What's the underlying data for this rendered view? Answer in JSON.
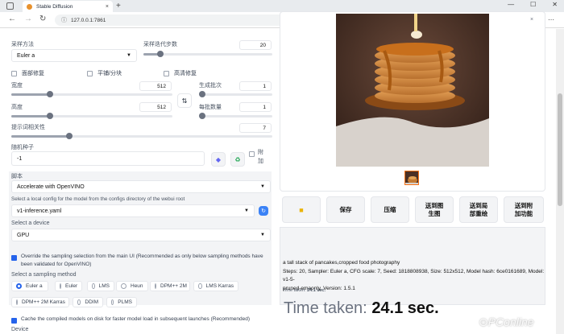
{
  "browser": {
    "tab_title": "Stable Diffusion",
    "url": "127.0.0.1:7861",
    "tab_close": "×",
    "new_tab": "+",
    "win_min": "—",
    "win_max": "☐",
    "win_close": "✕"
  },
  "left": {
    "sampler_label": "采样方法",
    "sampler_value": "Euler a",
    "steps_label": "采样迭代步数",
    "steps_value": "20",
    "steps_fraction": 0.13,
    "restore_faces": "面部修复",
    "tiling": "平铺/分块",
    "hires_fix": "高清修复",
    "width_label": "宽度",
    "width_value": "512",
    "height_label": "高度",
    "height_value": "512",
    "batch_count_label": "生成批次",
    "batch_count_value": "1",
    "batch_size_label": "每批数量",
    "batch_size_value": "1",
    "cfg_label": "提示词相关性",
    "cfg_value": "7",
    "seed_label": "随机种子",
    "seed_value": "-1",
    "extra_label": "附加",
    "script_label": "脚本",
    "script_value": "Accelerate with OpenVINO",
    "config_label": "Select a local config for the model from the configs directory of the webui root",
    "config_value": "v1-inference.yaml",
    "device_label": "Select a device",
    "device_value": "GPU",
    "override_text": "Override the sampling selection from the main UI (Recommended as only below sampling methods have been validated for OpenVINO)",
    "sampling_method_label": "Select a sampling method",
    "methods": [
      "Euler a",
      "Euler",
      "LMS",
      "Heun",
      "DPM++ 2M",
      "LMS Karras",
      "DPM++ 2M Karras",
      "DDIM",
      "PLMS"
    ],
    "cache_text": "Cache the compiled models on disk for faster model load in subsequent launches (Recommended)",
    "device_footer": "Device"
  },
  "right": {
    "buttons": [
      "保存",
      "压缩",
      "送到图生图",
      "送到局部重绘",
      "送到附加功能"
    ],
    "btn_i2i_l1": "送到图",
    "btn_i2i_l2": "生图",
    "btn_inpaint_l1": "送到局",
    "btn_inpaint_l2": "部重绘",
    "btn_extras_l1": "送到附",
    "btn_extras_l2": "加功能",
    "prompt": "a tall stack of pancakes,cropped food photography",
    "params_line1": "Steps: 20, Sampler: Euler a, CFG scale: 7, Seed: 1818808938, Size: 512x512, Model hash: 6ce0161689, Model: v1-5-",
    "params_line2": "pruned-emaonly, Version: 1.5.1",
    "time_small_label": "Time taken:",
    "time_small_value": "24.1 sec.",
    "time_big_label": "Time taken:",
    "time_big_value": "24.1 sec."
  },
  "watermark": "PConline"
}
